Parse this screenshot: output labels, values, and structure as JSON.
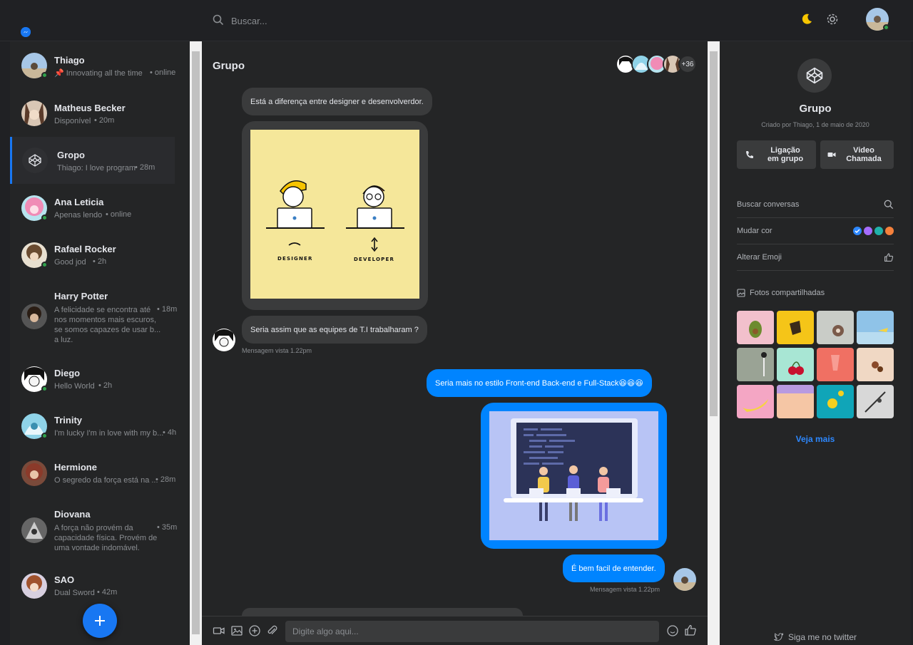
{
  "search": {
    "placeholder": "Buscar..."
  },
  "conversations": [
    {
      "name": "Thiago",
      "preview": "📌 Innovating all the time",
      "time": "online",
      "online": true
    },
    {
      "name": "Matheus Becker",
      "preview": "Disponível",
      "time": "20m",
      "online": false
    },
    {
      "name": "Gropo",
      "preview": "Thiago: I love program",
      "time": "28m",
      "online": false
    },
    {
      "name": "Ana Leticia",
      "preview": "Apenas lendo",
      "time": "online",
      "online": true
    },
    {
      "name": "Rafael Rocker",
      "preview": "Good jod",
      "time": "2h",
      "online": true
    },
    {
      "name": "Harry Potter",
      "preview_lines": [
        "A felicidade se encontra até",
        "nos momentos mais escuros,",
        "se somos capazes de usar b...",
        "a luz."
      ],
      "time": "18m",
      "online": false
    },
    {
      "name": "Diego",
      "preview": "Hello World",
      "time": "2h",
      "online": true
    },
    {
      "name": "Trinity",
      "preview": "I'm lucky I'm in love with my b...",
      "time": "4h",
      "online": true
    },
    {
      "name": "Hermione",
      "preview": "O segredo da força está na ...",
      "time": "28m",
      "online": false
    },
    {
      "name": "Diovana",
      "preview_lines": [
        "A força não provém da",
        "capacidade física. Provém de",
        "uma vontade indomável."
      ],
      "time": "35m",
      "online": false
    },
    {
      "name": "SAO",
      "preview": "Dual Sword",
      "time": "42m",
      "online": false
    }
  ],
  "chat": {
    "title": "Grupo",
    "members_more": "+36",
    "messages": {
      "m1": "Está a diferença entre designer e desenvolverdor.",
      "img1": {
        "label_left": "DESIGNER",
        "label_right": "DEVELOPER"
      },
      "m2": "Seria assim que as equipes de T.I trabalharam ?",
      "seen1": "Mensagem vista 1.22pm",
      "m3": "Seria mais no estilo Front-end Back-end e Full-Stack😆😆😆",
      "m4": "É bem facil de entender.",
      "seen2": "Mensagem vista 1.22pm"
    },
    "composer_placeholder": "Digite algo aqui..."
  },
  "details": {
    "name": "Grupo",
    "created": "Criado por Thiago, 1 de maio de 2020",
    "call_group": "Ligação em grupo",
    "video_call": "Video Chamada",
    "options": {
      "search": "Buscar conversas",
      "color": "Mudar cor",
      "emoji": "Alterar Emoji"
    },
    "swatch_colors": [
      "#2d88ff",
      "#a66cff",
      "#20b2aa",
      "#f5813c"
    ],
    "photos_title": "Fotos compartilhadas",
    "see_more": "Veja mais",
    "twitter": "Siga me no twitter"
  },
  "colors": {
    "accent": "#0084ff",
    "background": "#202124",
    "panel": "#242526",
    "online": "#31a24c"
  }
}
